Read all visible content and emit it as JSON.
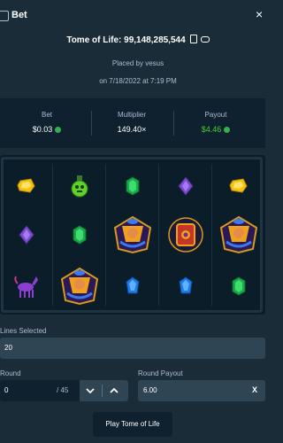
{
  "header": {
    "title": "Bet",
    "close": "×"
  },
  "game": {
    "title": "Tome of Life: 99,148,285,544"
  },
  "meta": {
    "placed_by": "Placed by vesus",
    "date": "on 7/18/2022 at 7:19 PM"
  },
  "stats": {
    "bet_label": "Bet",
    "bet_value": "$0.03",
    "mult_label": "Multiplier",
    "mult_value": "149.40×",
    "payout_label": "Payout",
    "payout_value": "$4.46"
  },
  "grid": [
    [
      "gold-gem",
      "green-potion",
      "green-gem",
      "purple-gem",
      "gold-gem"
    ],
    [
      "purple-gem",
      "green-gem",
      "pharaoh-wild",
      "tome-scatter",
      "pharaoh-wild"
    ],
    [
      "purple-horse",
      "pharaoh-wild",
      "blue-gem",
      "blue-gem",
      "green-gem"
    ]
  ],
  "lines": {
    "label": "Lines Selected",
    "value": "20"
  },
  "round": {
    "label": "Round",
    "value": "0",
    "total": "/ 45"
  },
  "round_payout": {
    "label": "Round Payout",
    "value": "6.00",
    "clear": "X"
  },
  "play_button": "Play Tome of Life",
  "colors": {
    "bg": "#1a2c38",
    "panel": "#0f212e",
    "field": "#2f4553",
    "green": "#4ad02e"
  }
}
